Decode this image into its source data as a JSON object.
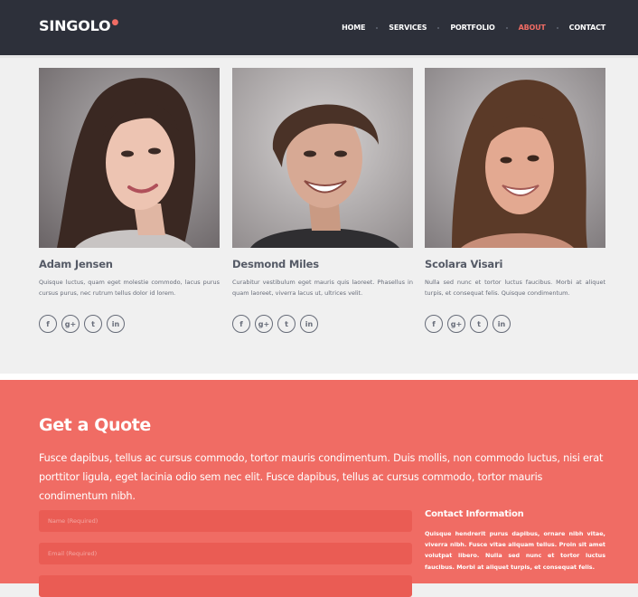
{
  "brand": {
    "logo": "SINGOLO",
    "logo_mark": "●"
  },
  "nav": [
    {
      "label": "HOME",
      "active": false
    },
    {
      "label": "SERVICES",
      "active": false
    },
    {
      "label": "PORTFOLIO",
      "active": false
    },
    {
      "label": "ABOUT",
      "active": true
    },
    {
      "label": "CONTACT",
      "active": false
    }
  ],
  "team": [
    {
      "name": "Adam Jensen",
      "bio": "Quisque luctus, quam eget molestie commodo, lacus purus cursus purus, nec rutrum tellus dolor id lorem.",
      "socials": [
        "f",
        "g+",
        "t",
        "in"
      ]
    },
    {
      "name": "Desmond Miles",
      "bio": "Curabitur vestibulum eget mauris quis laoreet. Phasellus in quam laoreet, viverra lacus ut, ultrices velit.",
      "socials": [
        "f",
        "g+",
        "t",
        "in"
      ]
    },
    {
      "name": "Scolara Visari",
      "bio": "Nulla sed nunc et tortor luctus faucibus. Morbi at aliquet turpis, et consequat felis. Quisque condimentum.",
      "socials": [
        "f",
        "g+",
        "t",
        "in"
      ]
    }
  ],
  "quote": {
    "title": "Get a Quote",
    "description": "Fusce dapibus, tellus ac cursus commodo, tortor mauris condimentum. Duis mollis, non commodo luctus, nisi erat porttitor ligula, eget lacinia odio sem nec elit. Fusce dapibus, tellus ac cursus commodo, tortor mauris condimentum nibh.",
    "fields": {
      "name_placeholder": "Name (Required)",
      "email_placeholder": "Email (Required)",
      "subject_placeholder": ""
    }
  },
  "contact_info": {
    "title": "Contact Information",
    "text": "Quisque hendrerit purus dapibus, ornare nibh vitae, viverra nibh. Fusce vitae aliquam tellus. Proin sit amet volutpat libero. Nulla sed nunc et tortor luctus faucibus. Morbi at aliquet turpis, et consequat felis."
  },
  "colors": {
    "header_bg": "#2d303a",
    "accent": "#f06c64",
    "section_bg": "#f0f0f0",
    "text": "#555a66"
  }
}
